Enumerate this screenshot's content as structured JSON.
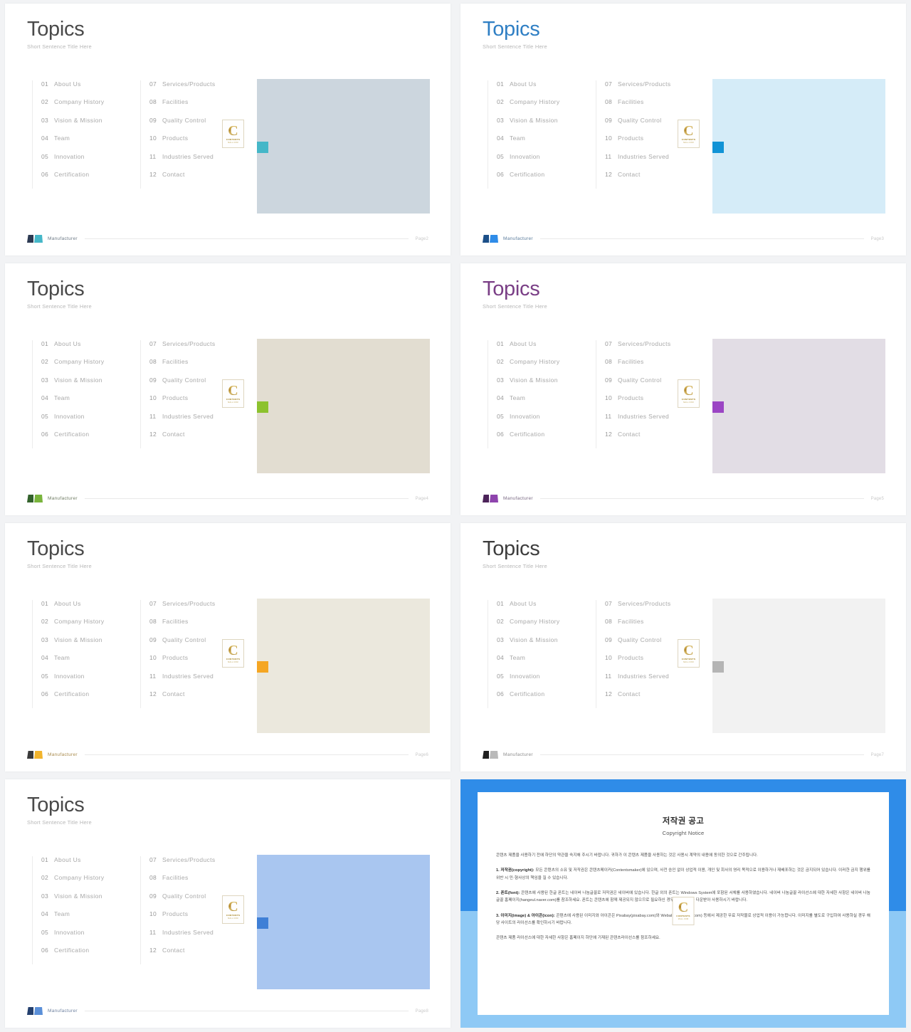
{
  "slide_common": {
    "title": "Topics",
    "subtitle": "Short Sentence Title Here",
    "brand_name": "Manufacturer",
    "badge": {
      "letter": "C",
      "line1": "CONTENTS",
      "line2": "MALL.COM"
    },
    "columns": [
      {
        "items": [
          {
            "num": "01",
            "label": "About Us"
          },
          {
            "num": "02",
            "label": "Company History"
          },
          {
            "num": "03",
            "label": "Vision & Mission"
          },
          {
            "num": "04",
            "label": "Team"
          },
          {
            "num": "05",
            "label": "Innovation"
          },
          {
            "num": "06",
            "label": "Certification"
          }
        ]
      },
      {
        "items": [
          {
            "num": "07",
            "label": "Services/Products"
          },
          {
            "num": "08",
            "label": "Facilities"
          },
          {
            "num": "09",
            "label": "Quality Control"
          },
          {
            "num": "10",
            "label": "Products"
          },
          {
            "num": "11",
            "label": "Industries Served"
          },
          {
            "num": "12",
            "label": "Contact"
          }
        ]
      }
    ]
  },
  "slides": [
    {
      "id": "slide-page2",
      "page": "Page2",
      "theme": "slate",
      "panel_color": "#ccd6de",
      "accent_color": "#45b7c8",
      "title_color": "#4a4a4a",
      "logo_left_color": "#2c3a52",
      "logo_right_color": "#45b7c8",
      "brand_text_color": "#6d7a86"
    },
    {
      "id": "slide-page3",
      "page": "Page3",
      "theme": "blue",
      "panel_color": "#d5ecf8",
      "accent_color": "#1193d6",
      "title_color": "#2f7fc4",
      "logo_left_color": "#1b4f88",
      "logo_right_color": "#2f8ce8",
      "brand_text_color": "#5b7c9c"
    },
    {
      "id": "slide-page4",
      "page": "Page4",
      "theme": "beige",
      "panel_color": "#e2ddd1",
      "accent_color": "#8cc22e",
      "title_color": "#4a4a4a",
      "logo_left_color": "#33622c",
      "logo_right_color": "#79b43c",
      "brand_text_color": "#6f7c63"
    },
    {
      "id": "slide-page5",
      "page": "Page5",
      "theme": "lavender",
      "panel_color": "#e2dde5",
      "accent_color": "#9b45c4",
      "title_color": "#7a3f86",
      "logo_left_color": "#4b2259",
      "logo_right_color": "#8e44ad",
      "brand_text_color": "#7a6a84"
    },
    {
      "id": "slide-page6",
      "page": "Page6",
      "theme": "cream",
      "panel_color": "#ebe8dd",
      "accent_color": "#f5a623",
      "title_color": "#4a4a4a",
      "logo_left_color": "#3a3a3a",
      "logo_right_color": "#f2b42c",
      "brand_text_color": "#a98b4d"
    },
    {
      "id": "slide-page7",
      "page": "Page7",
      "theme": "gray",
      "panel_color": "#f2f2f2",
      "accent_color": "#b5b5b5",
      "title_color": "#3d3d3d",
      "logo_left_color": "#1f1f1f",
      "logo_right_color": "#b9b9b9",
      "brand_text_color": "#8d8d8d"
    },
    {
      "id": "slide-page8",
      "page": "Page8",
      "theme": "cornflower",
      "panel_color": "#a9c6f0",
      "accent_color": "#3f7fd6",
      "title_color": "#4a4a4a",
      "logo_left_color": "#24406e",
      "logo_right_color": "#5a8fd8",
      "brand_text_color": "#6f82a0"
    }
  ],
  "copyright": {
    "heading_ko": "저작권 공고",
    "heading_en": "Copyright Notice",
    "intro": "콘텐츠 제품을 사용하기 전에 하단의 약관을 숙지해 주시기 바랍니다. 귀하가 이 콘텐츠 제품을 사용하는 것은 사용시 계약의 내용에 동의한 것으로 간주됩니다.",
    "sections": [
      {
        "label": "1. 저작권(copyright):",
        "text": " 모든 콘텐츠의 소유 및 저작권은 콘텐츠메이커(Contentsmaker)에 있으며, 사전 승인 없이 상업적 이용, 개인 및 회사의 영리 목적으로 이용하거나 재배포하는 것은 금지되어 있습니다. 이러한 금지 행위를 위반 시 민·형사상의 책임을 질 수 있습니다."
      },
      {
        "label": "2. 폰트(font):",
        "text": " 콘텐츠에 사용된 한글 폰트는 네이버 나눔글꼴로 저작권은 네이버에 있습니다. 한글 외의 폰트는 Windows System에 포함된 서체를 사용하였습니다. 네이버 나눔글꼴 라이선스에 대한 자세한 사항은 네이버 나눔글꼴 홈페이지(hangeul.naver.com)를 참조하세요. 폰트는 콘텐츠에 함께 제공되지 않으므로 필요하신 경우 해당 폰트를 다운받아 사용하시기 바랍니다."
      },
      {
        "label": "3. 이미지(image) & 아이콘(icon):",
        "text": " 콘텐츠에 사용된 이미지와 아이콘은 Pixabay(pixabay.com)와 Webalys(webalys.com) 등에서 제공한 무료 저작물로 상업적 이용이 가능합니다. 이미지를 별도로 구입하여 사용하실 경우 해당 사이트의 라이선스를 확인하시기 바랍니다."
      }
    ],
    "outro": "콘텐츠 제품 라이선스에 대한 자세한 사항은 홈페이지 하단에 기재된 콘텐츠라이선스를 참조하세요."
  }
}
